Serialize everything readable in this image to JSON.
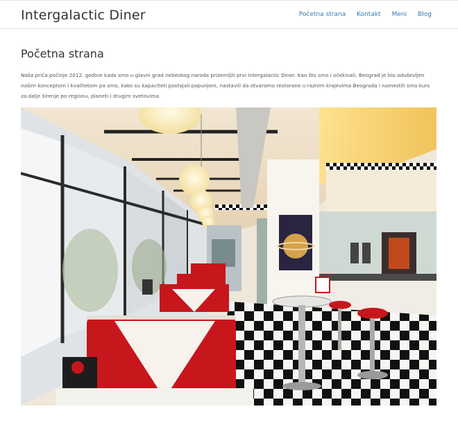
{
  "header": {
    "brand": "Intergalactic Diner",
    "nav": [
      "Početna strana",
      "Kontakt",
      "Meni",
      "Blog"
    ]
  },
  "main": {
    "title": "Početna strana",
    "intro": "Naša priča počinje 2012. godine kada smo u glavni grad nebeskog naroda prizemljili prvi Intergalactic Diner. Kao što smo i očekivali, Beograd je bio oduševljen našim konceptom i kvalitetom pa smo, kako su kapaciteti postajali popunjeni, nastavili da otvaramo restorane u raznim krajevima Beograda i namestili smo kurs za dalje širenje po regionu, planeti i drugim svetovima."
  },
  "colors": {
    "link": "#337ab7",
    "accent_red": "#c8161d"
  }
}
